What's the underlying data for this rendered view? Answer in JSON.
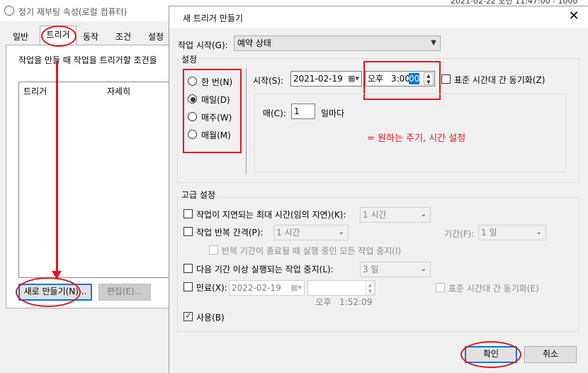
{
  "back_window": {
    "title": "정기 재부팅 속성(로컬 컴퓨터)",
    "tabs": [
      "일반",
      "트리거",
      "동작",
      "조건",
      "설정"
    ],
    "description": "작업을 만들 때 작업을 트리거할 조건을",
    "list_headers": [
      "트리거",
      "자세히"
    ],
    "buttons": {
      "new": "새로 만들기(N)...",
      "edit": "편집(E)..."
    },
    "partial_clock": "2021-02-22 오전 11:47:00 - 1000"
  },
  "dialog": {
    "title": "새 트리거 만들기",
    "close_icon": "close-icon",
    "begin_task_label": "작업 시작(G):",
    "begin_task_value": "예약 상태",
    "settings_group": "설정",
    "schedule_options": [
      "한 번(N)",
      "매일(D)",
      "매주(W)",
      "매월(M)"
    ],
    "schedule_selected": "매일(D)",
    "start_label": "시작(S):",
    "start_date": "2021-02-19",
    "start_ampm": "오후",
    "start_time_main": "3:00:",
    "start_time_selected": "00",
    "sync_label": "표준 시간대 간 동기화(Z)",
    "recur_label": "매(C):",
    "recur_value": "1",
    "recur_unit": "일마다",
    "annotation": "= 원하는 주기, 시간 설정",
    "advanced_group": "고급 설정",
    "delay_label": "작업이 지연되는 최대 시간(임의 지연)(K):",
    "delay_value": "1 시간",
    "repeat_label": "작업 반복 간격(P):",
    "repeat_value": "1 시간",
    "duration_label": "기간(F):",
    "duration_value": "1 일",
    "stop_all_label": "반복 기간이 종료될 때 실행 중인 모든 작업 중지(I)",
    "stop_longer_label": "다음 기간 이상 실행되는 작업 중지(L):",
    "stop_longer_value": "3 일",
    "expire_label": "만료(X):",
    "expire_date": "2022-02-19",
    "expire_time": "오후   1:52:09",
    "expire_sync_label": "표준 시간대 간 동기화(E)",
    "enabled_label": "사용(B)",
    "ok_button": "확인",
    "cancel_button": "취소"
  },
  "colors": {
    "annotation_red": "#e0161d",
    "focus_blue": "#0078d7"
  }
}
